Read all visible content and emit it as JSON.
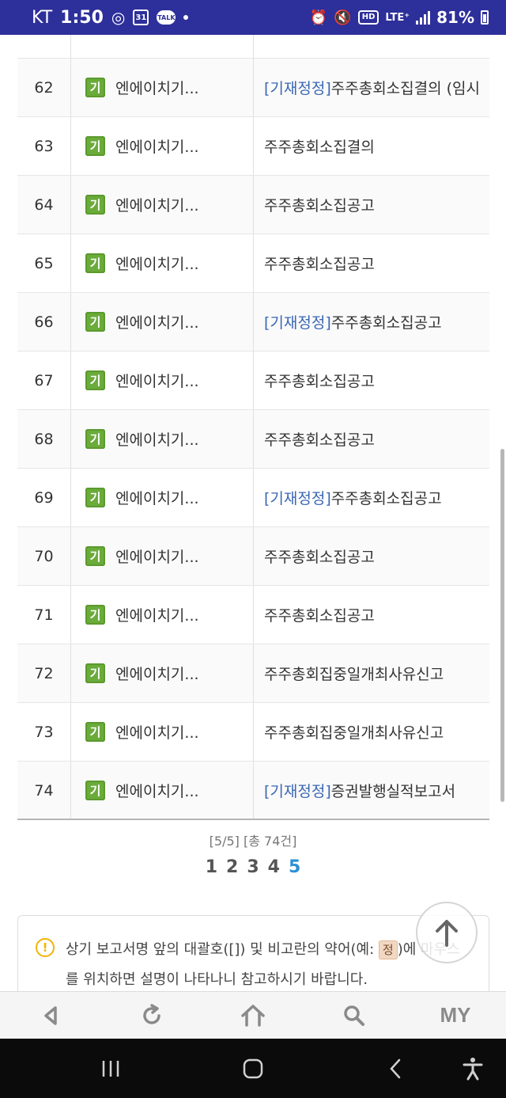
{
  "status_bar": {
    "carrier": "KT",
    "time": "1:50",
    "calendar_day": "31",
    "talk": "TALK",
    "network_hd": "HD",
    "network_lte": "LTE⁺",
    "battery": "81%"
  },
  "table": {
    "rows": [
      {
        "num": "",
        "badge": "",
        "company": "",
        "tag": "",
        "report": ""
      },
      {
        "num": "62",
        "badge": "기",
        "company": "엔에이치기...",
        "tag": "[기재정정]",
        "report": "주주총회소집결의 (임시"
      },
      {
        "num": "63",
        "badge": "기",
        "company": "엔에이치기...",
        "tag": "",
        "report": "주주총회소집결의"
      },
      {
        "num": "64",
        "badge": "기",
        "company": "엔에이치기...",
        "tag": "",
        "report": "주주총회소집공고"
      },
      {
        "num": "65",
        "badge": "기",
        "company": "엔에이치기...",
        "tag": "",
        "report": "주주총회소집공고"
      },
      {
        "num": "66",
        "badge": "기",
        "company": "엔에이치기...",
        "tag": "[기재정정]",
        "report": "주주총회소집공고"
      },
      {
        "num": "67",
        "badge": "기",
        "company": "엔에이치기...",
        "tag": "",
        "report": "주주총회소집공고"
      },
      {
        "num": "68",
        "badge": "기",
        "company": "엔에이치기...",
        "tag": "",
        "report": "주주총회소집공고"
      },
      {
        "num": "69",
        "badge": "기",
        "company": "엔에이치기...",
        "tag": "[기재정정]",
        "report": "주주총회소집공고"
      },
      {
        "num": "70",
        "badge": "기",
        "company": "엔에이치기...",
        "tag": "",
        "report": "주주총회소집공고"
      },
      {
        "num": "71",
        "badge": "기",
        "company": "엔에이치기...",
        "tag": "",
        "report": "주주총회소집공고"
      },
      {
        "num": "72",
        "badge": "기",
        "company": "엔에이치기...",
        "tag": "",
        "report": "주주총회집중일개최사유신고"
      },
      {
        "num": "73",
        "badge": "기",
        "company": "엔에이치기...",
        "tag": "",
        "report": "주주총회집중일개최사유신고"
      },
      {
        "num": "74",
        "badge": "기",
        "company": "엔에이치기...",
        "tag": "[기재정정]",
        "report": "증권발행실적보고서"
      }
    ]
  },
  "pagination": {
    "info": "[5/5] [총 74건]",
    "pages": [
      "1",
      "2",
      "3",
      "4",
      "5"
    ],
    "current": "5"
  },
  "note": {
    "icon": "!",
    "text_before": "상기 보고서명 앞의 대괄호([]) 및 비고란의 약어(예: ",
    "badge": "정",
    "text_after": ")에 마우스를 위치하면 설명이 나타나니 참고하시기 바랍니다."
  },
  "toolbar": {
    "my_label": "MY"
  },
  "colors": {
    "status_bar": "#2d2f9a",
    "badge_green": "#6aab3a",
    "tag_blue": "#3a66b5",
    "active_page": "#2b8fd6"
  },
  "icons": [
    "back-icon",
    "refresh-icon",
    "home-icon",
    "search-icon",
    "scroll-top-arrow-icon",
    "recents-icon",
    "nav-home-icon",
    "nav-back-icon",
    "accessibility-icon",
    "warning-icon"
  ]
}
